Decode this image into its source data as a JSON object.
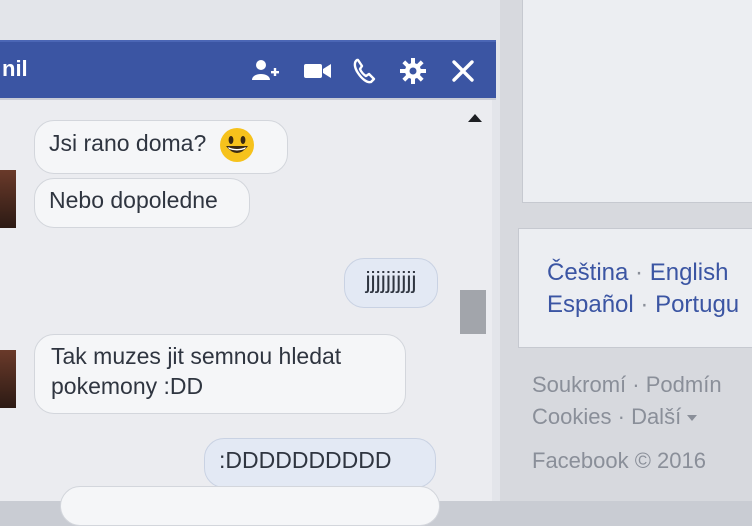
{
  "chat": {
    "title": "nil",
    "header_icons": [
      "add-person-icon",
      "video-call-icon",
      "phone-call-icon",
      "gear-icon",
      "close-icon"
    ],
    "messages": [
      {
        "side": "received",
        "text": "Jsi rano doma?",
        "emoji": "smiley-emoji"
      },
      {
        "side": "received",
        "text": "Nebo dopoledne"
      },
      {
        "side": "sent",
        "text": "jjjjjjjjjj"
      },
      {
        "side": "received",
        "text": "Tak muzes jit semnou hledat pokemony :DD"
      },
      {
        "side": "sent",
        "text": ":DDDDDDDDDD"
      }
    ]
  },
  "languages": {
    "row1": [
      "Čeština",
      "English"
    ],
    "row2": [
      "Español",
      "Portugu"
    ]
  },
  "footer": {
    "row1": [
      "Soukromí",
      "Podmín"
    ],
    "row2": [
      "Cookies",
      "Další"
    ],
    "copyright": "Facebook © 2016"
  },
  "colors": {
    "header_blue": "#3b55a3",
    "link_blue": "#3b55a3",
    "footer_gray": "#8a8f99"
  }
}
